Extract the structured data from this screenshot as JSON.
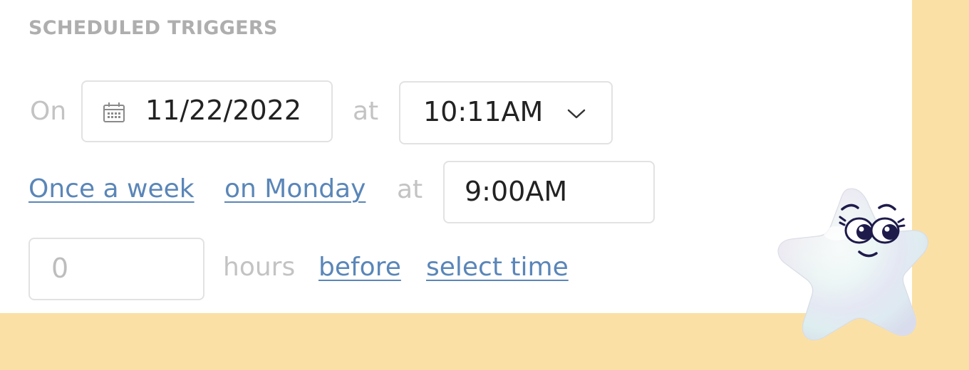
{
  "section": {
    "title": "SCHEDULED TRIGGERS"
  },
  "row1": {
    "on_label": "On",
    "date_value": "11/22/2022",
    "at_label": "at",
    "time_value": "10:11AM"
  },
  "row2": {
    "frequency_link": "Once a week",
    "day_link": "on Monday",
    "at_label": "at",
    "time_value": "9:00AM"
  },
  "row3": {
    "hours_value": "0",
    "hours_label": "hours",
    "before_link": "before",
    "select_time_link": "select time"
  },
  "icons": {
    "date": "calendar-icon",
    "dropdown": "chevron-down-icon",
    "mascot": "star-mascot-icon"
  },
  "colors": {
    "background": "#fbe0a6",
    "panel": "#ffffff",
    "link": "#5a86b8",
    "muted": "#c3c3c3",
    "text": "#222222",
    "border": "#e2e2e2",
    "title": "#aeaeae"
  }
}
